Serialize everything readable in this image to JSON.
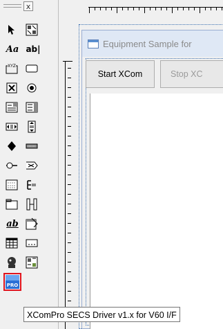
{
  "toolbox": {
    "close_glyph": "x",
    "text_tool_label": "Aa",
    "textbox_tool_label": "ab|",
    "groupbox_label": "XYZ",
    "underline_label": "ab",
    "selected_tool": "xcompro-control",
    "selected_tool_badge": "PRO",
    "tools": [
      "pointer",
      "picture",
      "label",
      "textbox",
      "frame",
      "command-button",
      "checkbox",
      "option-button",
      "combobox",
      "listbox",
      "hscrollbar",
      "vscrollbar",
      "timer",
      "drive-list",
      "dir-list",
      "file-list",
      "shape",
      "line",
      "image",
      "data",
      "ole",
      "xcompro"
    ]
  },
  "designer": {
    "form_caption": "Equipment Sample for",
    "start_button": "Start XCom",
    "stop_button": "Stop XC"
  },
  "tooltip": {
    "text": "XComPro SECS Driver v1.x for V60 I/F"
  },
  "colors": {
    "selection_border": "#e0141e",
    "title_bar": "#dfe8f5"
  }
}
